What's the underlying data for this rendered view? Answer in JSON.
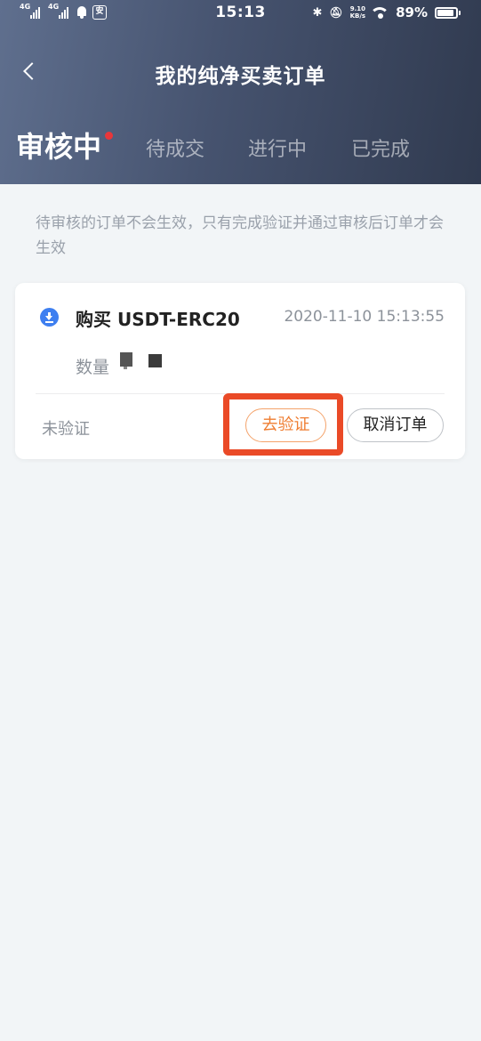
{
  "status_bar": {
    "network1": "4G",
    "network2": "4G",
    "app_badge": "安",
    "time": "15:13",
    "speed_value": "9.10",
    "speed_unit": "KB/s",
    "battery": "89%"
  },
  "header": {
    "title": "我的纯净买卖订单"
  },
  "tabs": [
    {
      "label": "审核中",
      "active": true,
      "has_dot": true
    },
    {
      "label": "待成交"
    },
    {
      "label": "进行中"
    },
    {
      "label": "已完成"
    }
  ],
  "notice": "待审核的订单不会生效，只有完成验证并通过审核后订单才会生效",
  "order": {
    "icon": "download-icon",
    "title": "购买 USDT-ERC20",
    "time": "2020-11-10 15:13:55",
    "quantity_label": "数量",
    "status": "未验证",
    "verify_button": "去验证",
    "cancel_button": "取消订单"
  },
  "colors": {
    "header_dark": "#303a4f",
    "accent_orange": "#ef7d31",
    "highlight_red": "#ea4a27",
    "dot_red": "#e8363a",
    "icon_blue": "#3e7ff0"
  }
}
